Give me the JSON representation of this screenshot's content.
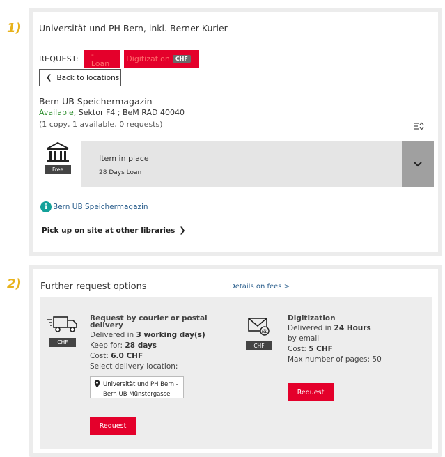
{
  "markers": {
    "step1": "1)",
    "step2": "2)"
  },
  "panel1": {
    "title": "Universität und PH Bern, inkl. Berner Kurier",
    "request_label": "REQUEST:",
    "loan_label": "- Loan",
    "digitization_label": "Digitization",
    "digitization_badge": "CHF",
    "back_label": "Back to locations",
    "location": {
      "name": "Bern UB Speichermagazin",
      "availability": "Available",
      "shelf": ", Sektor F4 ; BeM RAD 40040",
      "copies": "(1 copy, 1 available, 0 requests)"
    },
    "item": {
      "icon": "library-building-icon",
      "badge": "Free",
      "title": "Item in place",
      "subtitle": "28 Days Loan"
    },
    "info_link": "Bern UB Speichermagazin",
    "pickup_label": "Pick up on site at other libraries"
  },
  "panel2": {
    "title": "Further request options",
    "fees_link": "Details on fees >",
    "courier": {
      "icon": "delivery-truck-icon",
      "badge": "CHF",
      "title": "Request by courier or postal delivery",
      "delivered_prefix": "Delivered in ",
      "delivered_value": "3 working day(s)",
      "keep_prefix": "Keep for: ",
      "keep_value": "28 days",
      "cost_prefix": "Cost: ",
      "cost_value": "6.0 CHF",
      "select_label": "Select delivery location:",
      "location_line1": "Universität und PH Bern -",
      "location_line2": "Bern UB Münstergasse",
      "request_label": "Request"
    },
    "digitization": {
      "icon": "email-envelope-icon",
      "badge": "CHF",
      "title": "Digitization",
      "delivered_prefix": "Delivered in ",
      "delivered_value": "24 Hours",
      "by_email": "by email",
      "cost_prefix": "Cost: ",
      "cost_value": "5 CHF",
      "max_pages": "Max number of pages: 50",
      "request_label": "Request"
    }
  },
  "colors": {
    "accent_red": "#e4002b",
    "available_green": "#2f8f2f",
    "link_blue": "#2a5e8c",
    "info_teal": "#14a19a",
    "marker_yellow": "#e8b21a"
  }
}
